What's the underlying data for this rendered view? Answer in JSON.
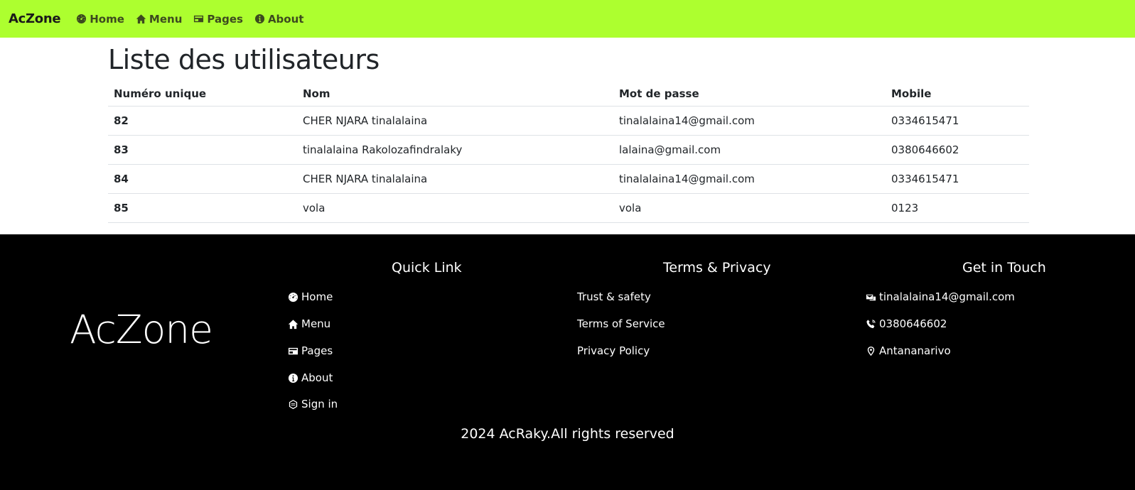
{
  "navbar": {
    "brand": "AcZone",
    "links": [
      {
        "label": "Home",
        "icon": "speedometer-icon"
      },
      {
        "label": "Menu",
        "icon": "house-icon"
      },
      {
        "label": "Pages",
        "icon": "card-icon"
      },
      {
        "label": "About",
        "icon": "info-icon"
      }
    ]
  },
  "main": {
    "title": "Liste des utilisateurs",
    "table": {
      "headers": [
        "Numéro unique",
        "Nom",
        "Mot de passe",
        "Mobile"
      ],
      "rows": [
        [
          "82",
          "CHER NJARA tinalalaina",
          "tinalalaina14@gmail.com",
          "0334615471"
        ],
        [
          "83",
          "tinalalaina Rakolozafindralaky",
          "lalaina@gmail.com",
          "0380646602"
        ],
        [
          "84",
          "CHER NJARA tinalalaina",
          "tinalalaina14@gmail.com",
          "0334615471"
        ],
        [
          "85",
          "vola",
          "vola",
          "0123"
        ]
      ]
    }
  },
  "footer": {
    "logo": "AcZone",
    "quick_link": {
      "heading": "Quick Link",
      "items": [
        {
          "label": "Home",
          "icon": "speedometer-icon"
        },
        {
          "label": "Menu",
          "icon": "house-icon"
        },
        {
          "label": "Pages",
          "icon": "card-icon"
        },
        {
          "label": "About",
          "icon": "info-icon"
        },
        {
          "label": "Sign in",
          "icon": "sign-in-icon"
        }
      ]
    },
    "terms": {
      "heading": "Terms & Privacy",
      "items": [
        "Trust & safety",
        "Terms of Service",
        "Privacy Policy"
      ]
    },
    "contact": {
      "heading": "Get in Touch",
      "email": "tinalalaina14@gmail.com",
      "phone": "0380646602",
      "location": "Antananarivo"
    },
    "copyright": "2024 AcRaky.All rights reserved"
  },
  "colors": {
    "navbar_bg": "#adff2f",
    "footer_bg": "#000000"
  }
}
